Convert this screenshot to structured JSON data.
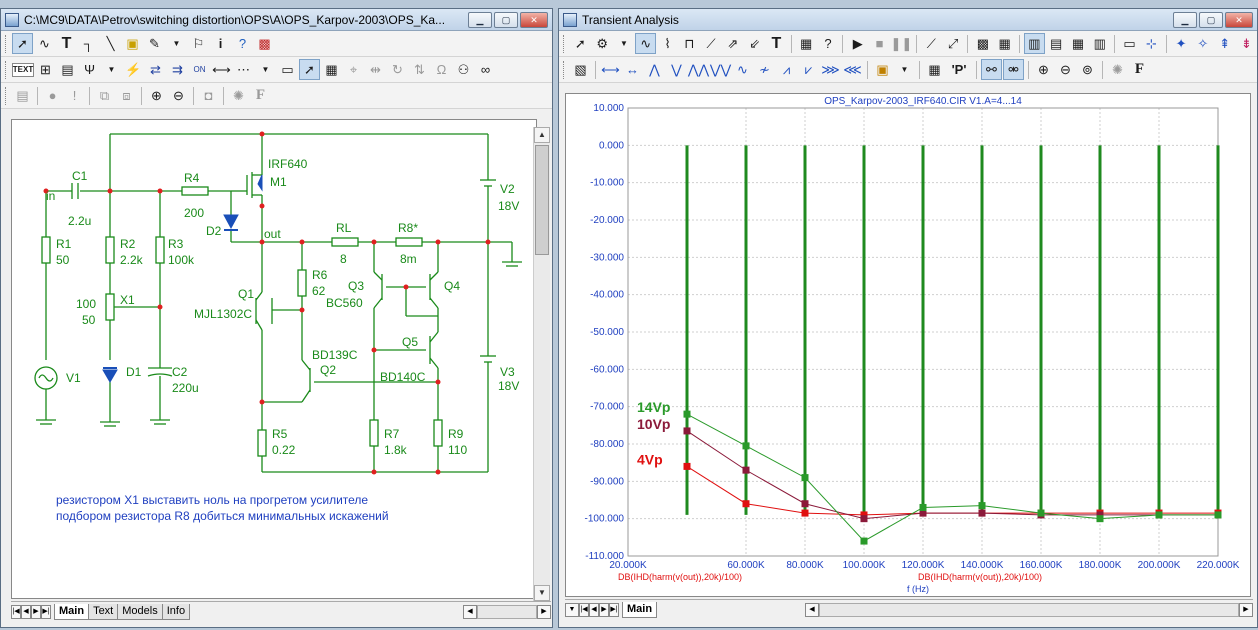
{
  "left_window": {
    "title": "C:\\MC9\\DATA\\Petrov\\switching distortion\\OPS\\A\\OPS_Karpov-2003\\OPS_Ka...",
    "tabs": [
      "Main",
      "Text",
      "Models",
      "Info"
    ],
    "active_tab": "Main",
    "toolbar1_text_icon": "TEXT",
    "schematic": {
      "labels": {
        "in": "in",
        "c1": "C1",
        "c1v": "2.2u",
        "r4": "R4",
        "r4v": "200",
        "m1": "IRF640",
        "m1n": "M1",
        "d2": "D2",
        "out": "out",
        "rl": "RL",
        "rlv": "8",
        "r8": "R8*",
        "r8v": "8m",
        "v2": "V2",
        "v2v": "18V",
        "r1": "R1",
        "r1v": "50",
        "r2": "R2",
        "r2v": "2.2k",
        "r3": "R3",
        "r3v": "100k",
        "r6": "R6",
        "r6v": "62",
        "q3": "Q3",
        "q3t": "BC560",
        "q4": "Q4",
        "x1": "X1",
        "x1a": "100",
        "x1b": "50",
        "q1": "Q1",
        "q1t": "MJL1302C",
        "q5": "Q5",
        "q2t": "BD139C",
        "q2": "Q2",
        "q5t": "BD140C",
        "v1": "V1",
        "d1": "D1",
        "c2": "C2",
        "c2v": "220u",
        "v3": "V3",
        "v3v": "18V",
        "r5": "R5",
        "r5v": "0.22",
        "r7": "R7",
        "r7v": "1.8k",
        "r9": "R9",
        "r9v": "110"
      },
      "note_line1": "резистором X1 выставить ноль на прогретом усилителе",
      "note_line2": "подбором резистора R8 добиться минимальных искажений"
    }
  },
  "right_window": {
    "title": "Transient Analysis",
    "tabs": [
      "Main"
    ],
    "active_tab": "Main",
    "toolbar_letter_p": "'P'",
    "toolbar_letter_f": "F"
  },
  "chart_data": {
    "type": "line",
    "title": "OPS_Karpov-2003_IRF640.CIR V1.A=4...14",
    "xlabel": "f (Hz)",
    "trace_label_left": "DB(IHD(harm(v(out)),20k)/100)",
    "trace_label_right": "DB(IHD(harm(v(out)),20k)/100)",
    "xlim": [
      20000,
      220000
    ],
    "ylim": [
      -110,
      10
    ],
    "x_ticks": [
      "20.000K",
      "60.000K",
      "80.000K",
      "100.000K",
      "120.000K",
      "140.000K",
      "160.000K",
      "180.000K",
      "200.000K",
      "220.000K"
    ],
    "y_ticks": [
      "10.000",
      "0.000",
      "-10.000",
      "-20.000",
      "-30.000",
      "-40.000",
      "-50.000",
      "-60.000",
      "-70.000",
      "-80.000",
      "-90.000",
      "-100.000",
      "-110.000"
    ],
    "grid": true,
    "harmonic_bars_x": [
      40000,
      60000,
      80000,
      100000,
      120000,
      140000,
      160000,
      180000,
      200000,
      220000
    ],
    "harmonic_bar_top": 0,
    "series": [
      {
        "name": "14Vp",
        "color": "#2a9a2a",
        "x": [
          40000,
          60000,
          80000,
          100000,
          120000,
          140000,
          160000,
          180000,
          200000,
          220000
        ],
        "values": [
          -72,
          -80.5,
          -89,
          -106,
          -97,
          -96.5,
          -98.5,
          -100,
          -99,
          -99
        ]
      },
      {
        "name": "10Vp",
        "color": "#8b1a3a",
        "x": [
          40000,
          60000,
          80000,
          100000,
          120000,
          140000,
          160000,
          180000,
          200000,
          220000
        ],
        "values": [
          -76.5,
          -87,
          -96,
          -100,
          -98.5,
          -98.5,
          -99,
          -99,
          -99,
          -99
        ]
      },
      {
        "name": "4Vp",
        "color": "#e01010",
        "x": [
          40000,
          60000,
          80000,
          100000,
          120000,
          140000,
          160000,
          180000,
          200000,
          220000
        ],
        "values": [
          -86,
          -96,
          -98.5,
          -99,
          -98.5,
          -98.5,
          -98.5,
          -98.5,
          -98.5,
          -98.5
        ]
      }
    ]
  }
}
